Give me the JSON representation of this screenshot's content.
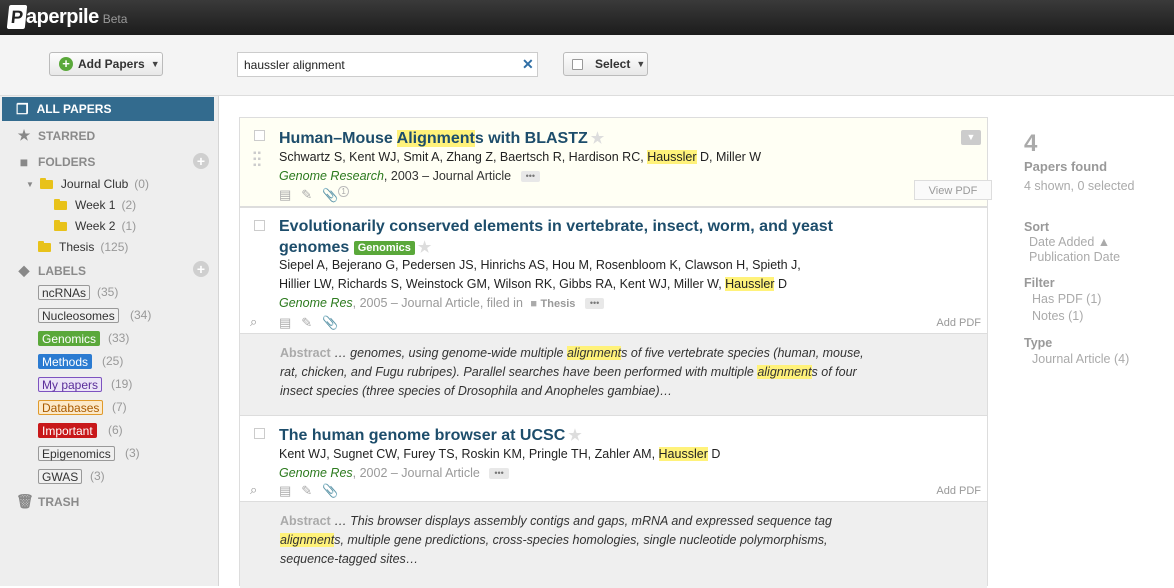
{
  "app": {
    "logo_letter": "P",
    "logo_rest": "aperpile",
    "beta": "Beta"
  },
  "toolbar": {
    "add_papers": "Add Papers",
    "search_value": "haussler alignment",
    "select": "Select"
  },
  "sidebar": {
    "all_papers": "ALL PAPERS",
    "starred": "STARRED",
    "folders": "FOLDERS",
    "folder_items": [
      {
        "name": "Journal Club",
        "count": "(0)"
      },
      {
        "name": "Week 1",
        "count": "(2)"
      },
      {
        "name": "Week 2",
        "count": "(1)"
      },
      {
        "name": "Thesis",
        "count": "(125)"
      }
    ],
    "labels": "LABELS",
    "label_items": [
      {
        "name": "ncRNAs",
        "count": "(35)",
        "bg": "#f0f0f0",
        "fg": "#333333",
        "border": "#999999"
      },
      {
        "name": "Nucleosomes",
        "count": "(34)",
        "bg": "#f0f0f0",
        "fg": "#333333",
        "border": "#999999"
      },
      {
        "name": "Genomics",
        "count": "(33)",
        "bg": "#5aa83a",
        "fg": "#ffffff",
        "border": "#5aa83a"
      },
      {
        "name": "Methods",
        "count": "(25)",
        "bg": "#2b7bd1",
        "fg": "#ffffff",
        "border": "#2b7bd1"
      },
      {
        "name": "My papers",
        "count": "(19)",
        "bg": "#ebe4f7",
        "fg": "#5a2d9a",
        "border": "#7d52c0"
      },
      {
        "name": "Databases",
        "count": "(7)",
        "bg": "#fce9c9",
        "fg": "#a85a00",
        "border": "#e09a2b"
      },
      {
        "name": "Important",
        "count": "(6)",
        "bg": "#c8181a",
        "fg": "#ffffff",
        "border": "#c8181a"
      },
      {
        "name": "Epigenomics",
        "count": "(3)",
        "bg": "#f0f0f0",
        "fg": "#333333",
        "border": "#999999"
      },
      {
        "name": "GWAS",
        "count": "(3)",
        "bg": "#f0f0f0",
        "fg": "#333333",
        "border": "#999999"
      }
    ],
    "trash": "TRASH"
  },
  "papers": [
    {
      "title_pre": "Human–Mouse ",
      "title_hl": "Alignment",
      "title_post": "s with BLASTZ",
      "authors_pre": "Schwartz S, Kent WJ, Smit A, Zhang Z, Baertsch R, Hardison RC, ",
      "authors_hl": "Haussler",
      "authors_post": " D, Miller W",
      "journal": "Genome Research",
      "year_type": ", 2003 – Journal Article",
      "attachment_count": "1",
      "action": "View PDF"
    },
    {
      "title_line1": "Evolutionarily conserved elements in vertebrate, insect, worm, and yeast",
      "title_line2": "genomes",
      "tag": "Genomics",
      "authors_line1": "Siepel A, Bejerano G, Pedersen JS, Hinrichs AS, Hou M, Rosenbloom K, Clawson H, Spieth J,",
      "authors_line2_pre": "Hillier LW, Richards S, Weinstock GM, Wilson RK, Gibbs RA, Kent WJ, Miller W, ",
      "authors_hl": "Haussler",
      "authors_post": " D",
      "journal": "Genome Res",
      "year_type": ", 2005 – Journal Article, filed in",
      "folder": "Thesis",
      "action": "Add PDF",
      "abstract_label": "Abstract",
      "abstract_l1_pre": " … genomes, using genome-wide multiple ",
      "abstract_l1_hl": "alignment",
      "abstract_l1_post": "s of five vertebrate species (human, mouse,",
      "abstract_l2_pre": "rat, chicken, and Fugu rubripes). Parallel searches have been performed with multiple ",
      "abstract_l2_hl": "alignment",
      "abstract_l2_post": "s of four",
      "abstract_l3": "insect species (three species of Drosophila and Anopheles gambiae)…"
    },
    {
      "title": "The human genome browser at UCSC",
      "authors_pre": "Kent WJ, Sugnet CW, Furey TS, Roskin KM, Pringle TH, Zahler AM, ",
      "authors_hl": "Haussler",
      "authors_post": " D",
      "journal": "Genome Res",
      "year_type": ", 2002 – Journal Article",
      "action": "Add PDF",
      "abstract_label": "Abstract",
      "abstract_l1": " … This browser displays assembly contigs and gaps, mRNA and expressed sequence tag",
      "abstract_l2_hl": "alignment",
      "abstract_l2_post": "s, multiple gene predictions, cross-species homologies, single nucleotide polymorphisms,",
      "abstract_l3": "sequence-tagged sites…"
    }
  ],
  "right_panel": {
    "count": "4",
    "found": "Papers found",
    "shown": "4 shown, 0 selected",
    "sort_head": "Sort",
    "sort_items": [
      "Date Added ▲",
      "Publication Date"
    ],
    "filter_head": "Filter",
    "filter_items": [
      "Has PDF (1)",
      "Notes (1)"
    ],
    "type_head": "Type",
    "type_items": [
      "Journal Article (4)"
    ]
  }
}
